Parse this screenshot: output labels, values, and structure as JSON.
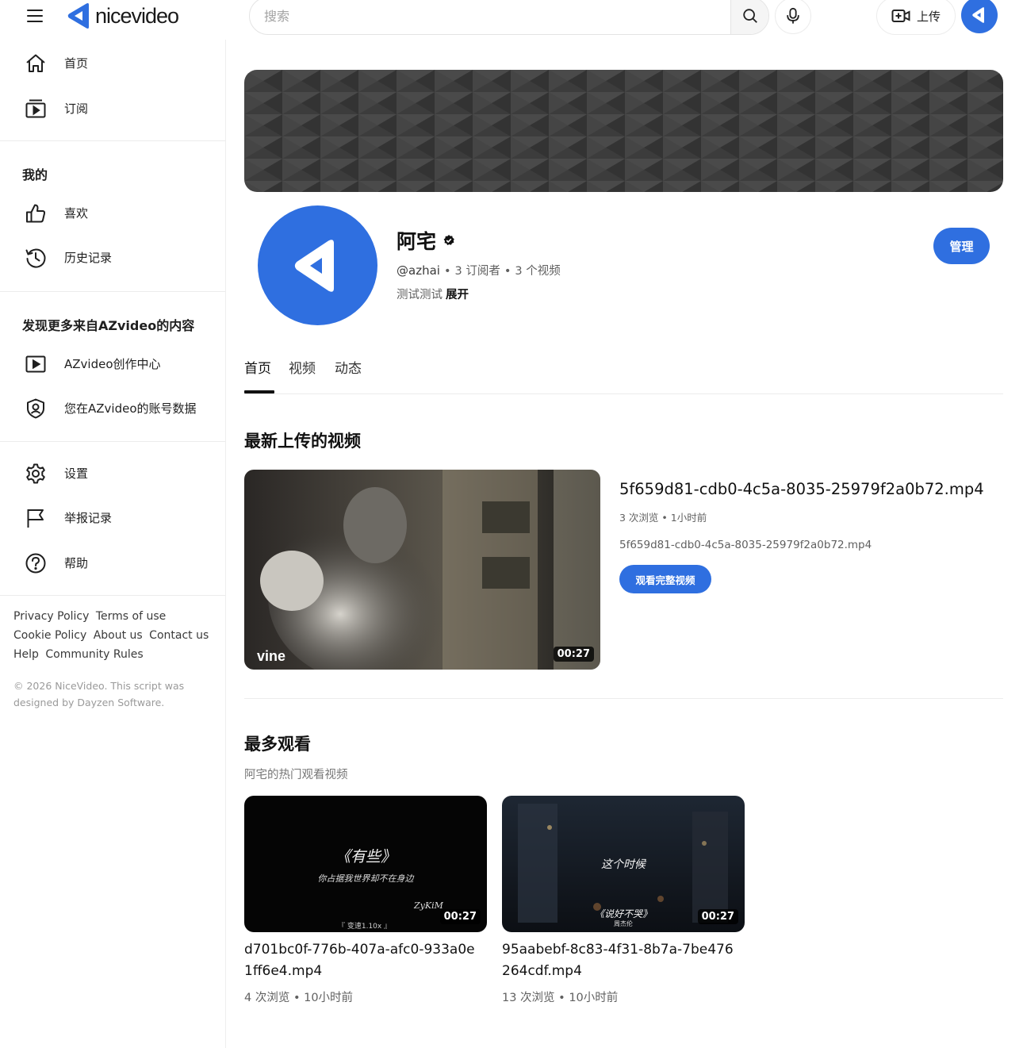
{
  "header": {
    "logo_text": "nicevideo",
    "search_placeholder": "搜索",
    "upload_label": "上传"
  },
  "sidebar": {
    "main_items": [
      {
        "label": "首页",
        "icon": "home-icon"
      },
      {
        "label": "订阅",
        "icon": "subscriptions-icon"
      }
    ],
    "mine_title": "我的",
    "mine_items": [
      {
        "label": "喜欢",
        "icon": "thumbs-up-icon"
      },
      {
        "label": "历史记录",
        "icon": "history-icon"
      }
    ],
    "discover_title": "发现更多来自AZvideo的内容",
    "discover_items": [
      {
        "label": "AZvideo创作中心",
        "icon": "play-box-icon"
      },
      {
        "label": "您在AZvideo的账号数据",
        "icon": "account-shield-icon"
      }
    ],
    "settings_items": [
      {
        "label": "设置",
        "icon": "gear-icon"
      },
      {
        "label": "举报记录",
        "icon": "flag-icon"
      },
      {
        "label": "帮助",
        "icon": "help-icon"
      }
    ],
    "footer_links": [
      "Privacy Policy",
      "Terms of use",
      "Cookie Policy",
      "About us",
      "Contact us",
      "Help",
      "Community Rules"
    ],
    "copyright": "© 2026 NiceVideo. This script was designed by Dayzen Software."
  },
  "channel": {
    "name": "阿宅",
    "handle": "@azhai",
    "subscribers": "3 订阅者",
    "videos": "3 个视频",
    "description": "测试测试",
    "more_label": "展开",
    "manage_label": "管理"
  },
  "tabs": [
    "首页",
    "视频",
    "动态"
  ],
  "latest": {
    "title": "最新上传的视频",
    "video": {
      "title": "5f659d81-cdb0-4c5a-8035-25979f2a0b72.mp4",
      "meta": "3 次浏览 • 1小时前",
      "description": "5f659d81-cdb0-4c5a-8035-25979f2a0b72.mp4",
      "duration": "00:27",
      "watch_label": "观看完整视频",
      "watermark": "vine"
    }
  },
  "popular": {
    "title": "最多观看",
    "subtitle": "阿宅的热门观看视频",
    "videos": [
      {
        "title": "d701bc0f-776b-407a-afc0-933a0e1ff6e4.mp4",
        "meta": "4 次浏览 • 10小时前",
        "duration": "00:27",
        "overlay_title": "《有些》",
        "overlay_line": "你占据我世界却不在身边",
        "overlay_author": "ZyKiM",
        "overlay_speed": "『 变速1.10x 』"
      },
      {
        "title": "95aabebf-8c83-4f31-8b7a-7be476264cdf.mp4",
        "meta": "13 次浏览 • 10小时前",
        "duration": "00:27",
        "overlay_title": "这个时候",
        "overlay_line": "《说好不哭》",
        "overlay_author": "周杰伦"
      }
    ]
  },
  "colors": {
    "brand": "#2f6fe0",
    "text": "#0f0f0f",
    "muted": "#606060"
  }
}
